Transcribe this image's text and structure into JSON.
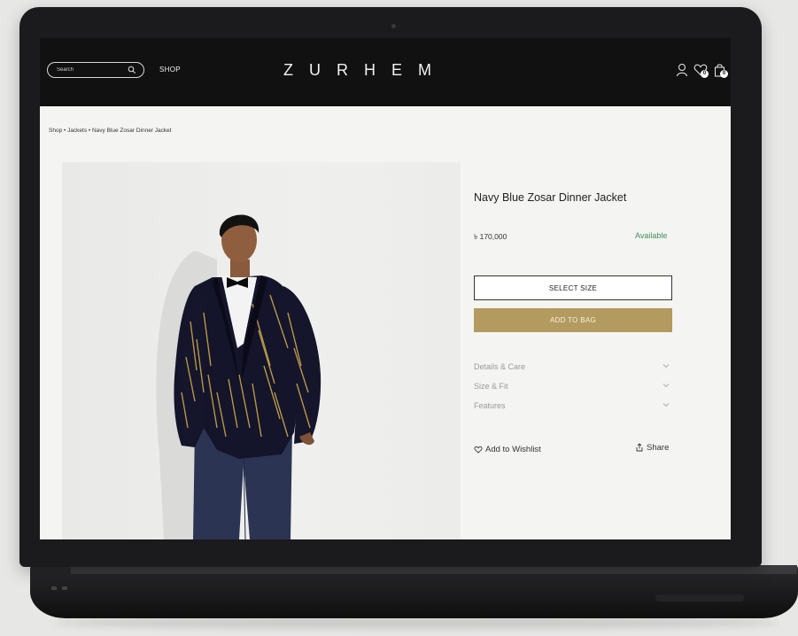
{
  "header": {
    "search_placeholder": "Search",
    "nav_shop": "SHOP",
    "logo": "ZURHEM",
    "wishlist_count": "0",
    "bag_count": "0"
  },
  "breadcrumb": "Shop • Jackets • Navy Blue Zosar Dinner Jacket",
  "product": {
    "title": "Navy Blue Zosar Dinner Jacket",
    "price": "৳ 170,000",
    "availability": "Available",
    "select_size_label": "SELECT SIZE",
    "add_to_bag_label": "ADD TO BAG",
    "accordion": [
      "Details & Care",
      "Size & Fit",
      "Features"
    ],
    "wishlist_label": "Add to Wishlist",
    "share_label": "Share"
  },
  "colors": {
    "header_bg": "#111111",
    "accent_gold": "#b39a5e",
    "available_green": "#3f8f5a",
    "laptop_body": "#1b1b1d"
  }
}
